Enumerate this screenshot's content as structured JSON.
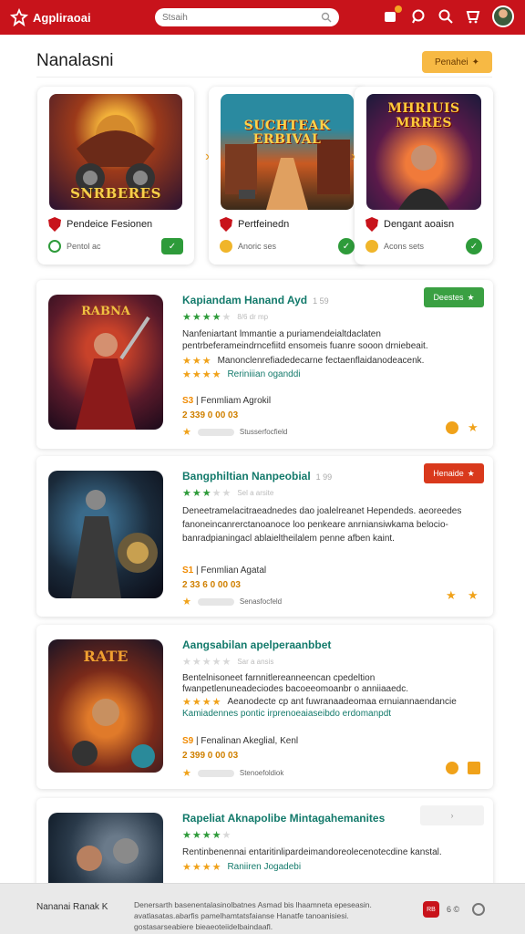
{
  "app": {
    "name": "Agpliraoai"
  },
  "search": {
    "placeholder": "Stsaih"
  },
  "header": {
    "title": "Nanalasni",
    "button_label": "Penahei"
  },
  "colors": {
    "brand": "#c8131b",
    "accent": "#f7b944",
    "green": "#3aa042",
    "teal": "#137a6b"
  },
  "featured": [
    {
      "art_title": "SNRBERES",
      "label": "Pendeice Fesionen",
      "meta": "Pentol ac",
      "icon": "shield-icon"
    },
    {
      "art_title": "SUCHTEAK ERBIVAL",
      "label": "Pertfeinedn",
      "meta": "Anoric ses",
      "icon": "shield-icon"
    },
    {
      "art_title": "MHRIUIS MRRES",
      "label": "Dengant aoaisn",
      "meta": "Acons sets",
      "icon": "shield-icon"
    }
  ],
  "list": [
    {
      "title": "Kapiandam Hanand Ayd",
      "sub": "1 59",
      "rating_count": "8/6 dr mp",
      "desc": "Nanfeniartant lmmantie a puriamendeialtdaclaten pentrbeferameindrncefiitd ensomeis fuanre sooon drniebeait.",
      "line2_a": "Manonclenrefiadedecarne fectaenflaidanodeacenk.",
      "line2_b": "Reriniiian oganddi",
      "meta_num": "S3",
      "meta_text": "Fenmliam Agrokil",
      "price": "2 339 0 00 03",
      "foot": "Stusserfocfield",
      "button": "Deestes"
    },
    {
      "title": "Bangphiltian Nanpeobial",
      "sub": "1 99",
      "rating_count": "Sel a arsite",
      "desc": "Deneetramelacitraeadnedes dao joalelreanet Hependeds. aeoreedes fanoneincanrerctanoanoce loo penkeare anrniansiwkama belocio-banradpianingacl ablaieltheilalem penne afben kaint.",
      "line2_a": "",
      "line2_b": "",
      "meta_num": "S1",
      "meta_text": "Fenmlian Agatal",
      "price": "2 33 6 0 00 03",
      "foot": "Senasfocfeld",
      "button": "Henaide"
    },
    {
      "title": "Aangsabilan apelperaanbbet",
      "sub": "",
      "rating_count": "Sar a ansis",
      "desc": "Bentelnisoneet farnnitlereanneencan cpedeltion fwanpetlenuneadeciodes bacoeeomoanbr o anniiaaedc.",
      "line2_a": "Aeanodecte cp ant fuwranaadeomaa ernuiannaendancie",
      "line2_b": "Kamiadennes pontic irprenoeaiaseibdo erdomanpdt",
      "meta_num": "S9",
      "meta_text": "Fenalinan Akeglial, Kenl",
      "price": "2 399 0 00 03",
      "foot": "Stenoefoldiok",
      "button": ""
    },
    {
      "title": "Rapeliat Aknapolibe Mintagahemanites",
      "sub": "",
      "rating_count": "",
      "desc": "Rentinbenennai entaritinlipardeimandoreolecenotecdine kanstal.",
      "line2_a": "",
      "line2_b": "Raniiren Jogadebi",
      "meta_num": "",
      "meta_text": "",
      "price": "",
      "foot": "",
      "button": ""
    }
  ],
  "footer": {
    "brand": "Nananai Ranak K",
    "text": "Denersarth basenentalasinolbatnes Asmad bis lhaamneta epeseasin. avatlasatas.abarfis pamelhamtatsfaianse Hanatfe tanoanisiesi. gostasarseabiere bieaeoteiidelbaindaafl.",
    "badge": "RB",
    "extra": "6 ©"
  }
}
